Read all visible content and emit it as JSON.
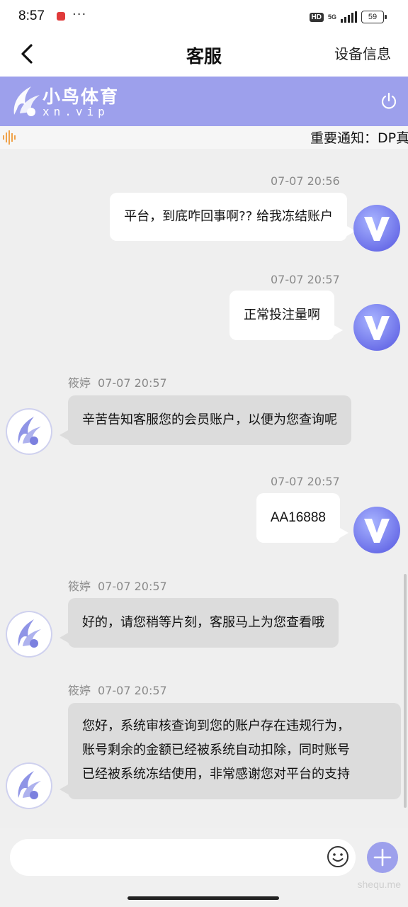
{
  "status": {
    "time": "8:57",
    "dots": "···",
    "hd": "HD",
    "net": "5G",
    "battery": "59"
  },
  "nav": {
    "title": "客服",
    "right": "设备信息"
  },
  "brand": {
    "name": "小鸟体育",
    "sub": "xn.vip"
  },
  "notice": {
    "text": "重要通知：DP真"
  },
  "messages": [
    {
      "side": "user",
      "time": "07-07 20:56",
      "lines": [
        "平台，到底咋回事啊??  给我冻结账户"
      ]
    },
    {
      "side": "user",
      "time": "07-07 20:57",
      "lines": [
        "正常投注量啊"
      ]
    },
    {
      "side": "agent",
      "name": "筱婷",
      "time": "07-07 20:57",
      "lines": [
        "辛苦告知客服您的会员账户，以便为您查询呢"
      ]
    },
    {
      "side": "user",
      "time": "07-07 20:57",
      "lines": [
        "AA16888"
      ]
    },
    {
      "side": "agent",
      "name": "筱婷",
      "time": "07-07 20:57",
      "lines": [
        "好的，请您稍等片刻，客服马上为您查看哦"
      ]
    },
    {
      "side": "agent",
      "name": "筱婷",
      "time": "07-07 20:57",
      "lines": [
        "您好，系统审核查询到您的账户存在违规行为，",
        "账号剩余的金额已经被系统自动扣除，同时账号",
        "已经被系统冻结使用，非常感谢您对平台的支持"
      ]
    }
  ],
  "input": {
    "value": "",
    "placeholder": ""
  },
  "watermark": "shequ.me",
  "colors": {
    "accent": "#9da0ec",
    "agent_bubble": "#dcdcdc",
    "user_bubble": "#ffffff",
    "background": "#efefef"
  },
  "icons": {
    "back": "chevron-left-icon",
    "power": "power-icon",
    "notice": "sound-wave-icon",
    "emoji": "smiley-icon",
    "add": "plus-icon",
    "user_avatar": "v-logo-icon",
    "agent_avatar": "bird-logo-icon"
  }
}
